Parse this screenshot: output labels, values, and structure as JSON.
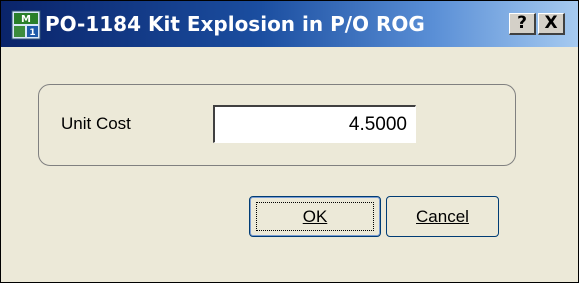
{
  "window": {
    "title": "PO-1184 Kit Explosion in P/O ROG",
    "help_label": "?",
    "close_label": "X"
  },
  "form": {
    "unit_cost_label": "Unit Cost",
    "unit_cost_value": "4.5000"
  },
  "buttons": {
    "ok_label": "OK",
    "cancel_label": "Cancel"
  },
  "icons": {
    "app": "app-icon",
    "help": "help-icon",
    "close": "close-icon"
  },
  "colors": {
    "titlebar_start": "#0a246a",
    "titlebar_end": "#a6caf0",
    "dialog_background": "#ece9d8",
    "button_border": "#003c74"
  }
}
